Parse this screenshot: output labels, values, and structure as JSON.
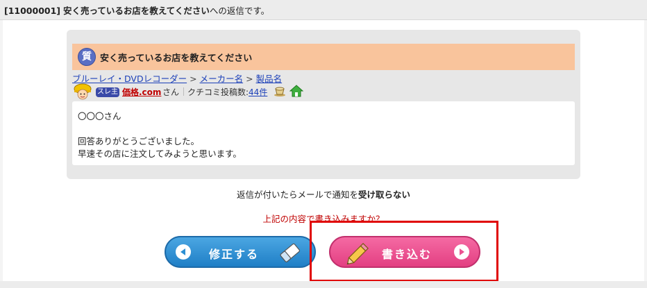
{
  "header": {
    "thread_id": "[11000001]",
    "thread_title": "安く売っているお店を教えてください",
    "suffix": "への返信です。"
  },
  "question": {
    "badge": "質",
    "title": "安く売っているお店を教えてください"
  },
  "breadcrumb": {
    "items": [
      "ブルーレイ・DVDレコーダー",
      "メーカー名",
      "製品名"
    ],
    "separator": ">"
  },
  "user": {
    "tag": "スレ主",
    "name": "価格.com",
    "honorific": "さん",
    "post_count_label": "クチコミ投稿数:",
    "post_count": "44件"
  },
  "message": {
    "lines": [
      "〇〇〇さん",
      "",
      "回答ありがとうございました。",
      "早速その店に注文してみようと思います。"
    ]
  },
  "notify": {
    "prefix": "返信が付いたらメールで通知を",
    "emphasis": "受け取らない"
  },
  "confirm": "上記の内容で書き込みますか？",
  "buttons": {
    "edit": "修正する",
    "write": "書き込む"
  },
  "colors": {
    "question_bar": "#f9c49c",
    "edit_button": "#2c8fd3",
    "write_button": "#ec5291",
    "highlight": "#e00000",
    "link": "#1b3fb8"
  }
}
